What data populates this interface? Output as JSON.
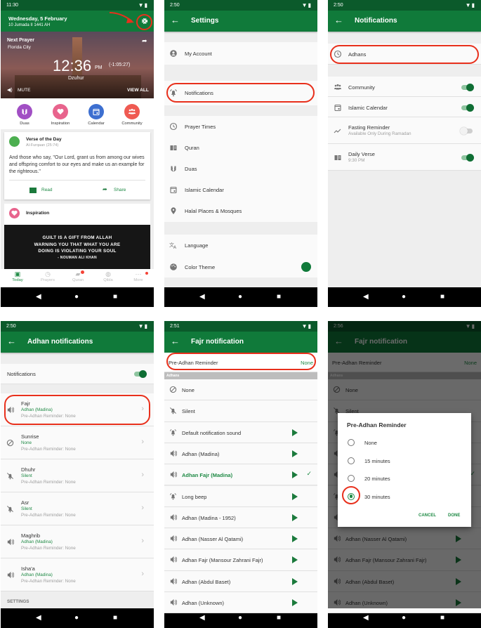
{
  "colors": {
    "primary": "#107a3a",
    "status_bar": "#0b5a2b",
    "accent": "#1f8a45",
    "annotation": "#e8301c"
  },
  "today": {
    "status_time": "11:30",
    "date": "Wednesday, 5 February",
    "hijri": "10 Jumada II 1441 AH",
    "next_prayer_label": "Next Prayer",
    "location": "Florida City",
    "time": "12:36",
    "ampm": "PM",
    "countdown": "(-1:05:27)",
    "prayer": "Dzuhur",
    "mute": "MUTE",
    "view_all": "VIEW ALL",
    "shortcuts": [
      {
        "label": "Duas",
        "color": "#a14fc4",
        "icon": "hands-icon"
      },
      {
        "label": "Inspiration",
        "color": "#e8648d",
        "icon": "heart-icon"
      },
      {
        "label": "Calendar",
        "color": "#3d6fd0",
        "icon": "calendar-icon"
      },
      {
        "label": "Community",
        "color": "#ef5a52",
        "icon": "community-icon"
      }
    ],
    "verse": {
      "title": "Verse of the Day",
      "ref": "Al-Furqaan (25:74)",
      "text": "And those who say, \"Our Lord, grant us from among our wives and offspring comfort to our eyes and make us an example for the righteous.\"",
      "read": "Read",
      "share": "Share"
    },
    "inspiration": {
      "title": "Inspiration",
      "quote": [
        "GUILT IS A GIFT FROM ALLAH",
        "WARNING YOU THAT WHAT YOU ARE",
        "DOING IS VIOLATING YOUR SOUL",
        "- NOUMAN ALI KHAN"
      ]
    },
    "tabs": [
      {
        "label": "Today",
        "active": true
      },
      {
        "label": "Prayers"
      },
      {
        "label": "Quran",
        "badge": true
      },
      {
        "label": "Qibla"
      },
      {
        "label": "More",
        "dot": true
      }
    ]
  },
  "settings": {
    "status_time": "2:50",
    "title": "Settings",
    "rows": [
      {
        "label": "My Account",
        "icon": "account-icon"
      },
      {
        "label": "Notifications",
        "icon": "bell-icon"
      },
      {
        "label": "Prayer Times",
        "icon": "clock-icon"
      },
      {
        "label": "Quran",
        "icon": "book-icon"
      },
      {
        "label": "Duas",
        "icon": "hands-icon"
      },
      {
        "label": "Islamic Calendar",
        "icon": "calendar-icon"
      },
      {
        "label": "Halal Places & Mosques",
        "icon": "location-icon"
      },
      {
        "label": "Language",
        "icon": "translate-icon"
      },
      {
        "label": "Color Theme",
        "icon": "palette-icon"
      }
    ],
    "theme_color": "#107a3a"
  },
  "notifications": {
    "status_time": "2:50",
    "title": "Notifications",
    "adhans": "Adhans",
    "rows": [
      {
        "label": "Community",
        "icon": "community-icon",
        "on": true
      },
      {
        "label": "Islamic Calendar",
        "icon": "calendar-icon",
        "on": true
      },
      {
        "label": "Fasting Reminder",
        "sub": "Available Only During Ramadan",
        "icon": "trend-icon",
        "on": false
      },
      {
        "label": "Daily Verse",
        "sub": "9:30 PM",
        "icon": "book-icon",
        "on": true
      }
    ]
  },
  "adhan_notifications": {
    "status_time": "2:50",
    "title": "Adhan notifications",
    "notifications_label": "Notifications",
    "notifications_on": true,
    "prayers": [
      {
        "name": "Fajr",
        "sound": "Adhan (Madina)",
        "reminder": "Pre-Adhan Reminder: None",
        "icon": "speaker-icon"
      },
      {
        "name": "Sunrise",
        "sound": "None",
        "reminder": "Pre-Adhan Reminder: None",
        "icon": "block-icon"
      },
      {
        "name": "Dhuhr",
        "sound": "Silent",
        "reminder": "Pre-Adhan Reminder: None",
        "icon": "bell-off-icon"
      },
      {
        "name": "Asr",
        "sound": "Silent",
        "reminder": "Pre-Adhan Reminder: None",
        "icon": "bell-off-icon"
      },
      {
        "name": "Maghrib",
        "sound": "Adhan (Madina)",
        "reminder": "Pre-Adhan Reminder: None",
        "icon": "speaker-icon"
      },
      {
        "name": "Isha'a",
        "sound": "Adhan (Madina)",
        "reminder": "Pre-Adhan Reminder: None",
        "icon": "speaker-icon"
      }
    ],
    "settings_header": "SETTINGS"
  },
  "fajr": {
    "status_time": "2:51",
    "title": "Fajr notification",
    "reminder_label": "Pre-Adhan Reminder",
    "reminder_value": "None",
    "section": "Adhans",
    "sounds": [
      {
        "label": "None",
        "icon": "block-icon",
        "play": false
      },
      {
        "label": "Silent",
        "icon": "bell-off-icon",
        "play": false
      },
      {
        "label": "Default notification sound",
        "icon": "bell-ring-icon",
        "play": true
      },
      {
        "label": "Adhan (Madina)",
        "icon": "speaker-icon",
        "play": true
      },
      {
        "label": "Adhan Fajr (Madina)",
        "icon": "speaker-icon",
        "play": true,
        "selected": true
      },
      {
        "label": "Long beep",
        "icon": "bell-ring-icon",
        "play": true
      },
      {
        "label": "Adhan (Madina - 1952)",
        "icon": "speaker-icon",
        "play": true
      },
      {
        "label": "Adhan (Nasser Al Qatami)",
        "icon": "speaker-icon",
        "play": true
      },
      {
        "label": "Adhan Fajr (Mansour Zahrani Fajr)",
        "icon": "speaker-icon",
        "play": true
      },
      {
        "label": "Adhan (Abdul Baset)",
        "icon": "speaker-icon",
        "play": true
      },
      {
        "label": "Adhan (Unknown)",
        "icon": "speaker-icon",
        "play": true
      }
    ]
  },
  "fajr_dialog": {
    "status_time": "2:56",
    "title": "Pre-Adhan Reminder",
    "options": [
      {
        "label": "None"
      },
      {
        "label": "15 minutes"
      },
      {
        "label": "20 minutes"
      },
      {
        "label": "30 minutes",
        "selected": true
      }
    ],
    "cancel": "CANCEL",
    "done": "DONE"
  }
}
